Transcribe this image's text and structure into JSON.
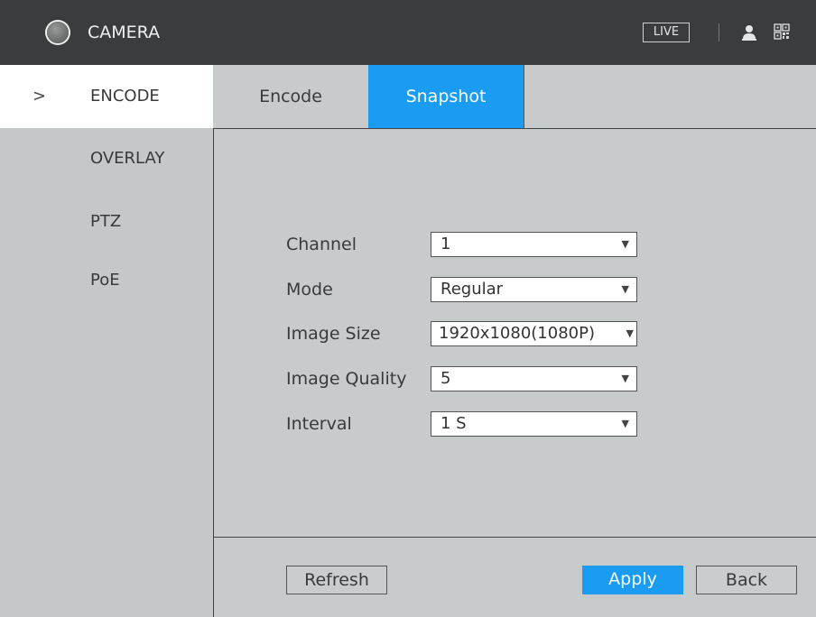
{
  "header": {
    "title": "CAMERA",
    "live_label": "LIVE",
    "icons": [
      "camera-icon",
      "user-icon",
      "qr-code-icon"
    ]
  },
  "sidebar": {
    "items": [
      {
        "label": "ENCODE",
        "active": true
      },
      {
        "label": "OVERLAY"
      },
      {
        "label": "PTZ"
      },
      {
        "label": "PoE"
      }
    ],
    "chevron": ">"
  },
  "tabs": [
    {
      "label": "Encode",
      "active": false
    },
    {
      "label": "Snapshot",
      "active": true
    }
  ],
  "form": {
    "channel": {
      "label": "Channel",
      "value": "1"
    },
    "mode": {
      "label": "Mode",
      "value": "Regular"
    },
    "image_size": {
      "label": "Image Size",
      "value": "1920x1080(1080P)"
    },
    "image_quality": {
      "label": "Image Quality",
      "value": "5"
    },
    "interval": {
      "label": "Interval",
      "value": "1 S"
    }
  },
  "buttons": {
    "refresh": "Refresh",
    "apply": "Apply",
    "back": "Back"
  },
  "colors": {
    "accent": "#1a9cf2",
    "header_bg": "#3a3c3d",
    "panel_bg": "#c7cbcb"
  }
}
